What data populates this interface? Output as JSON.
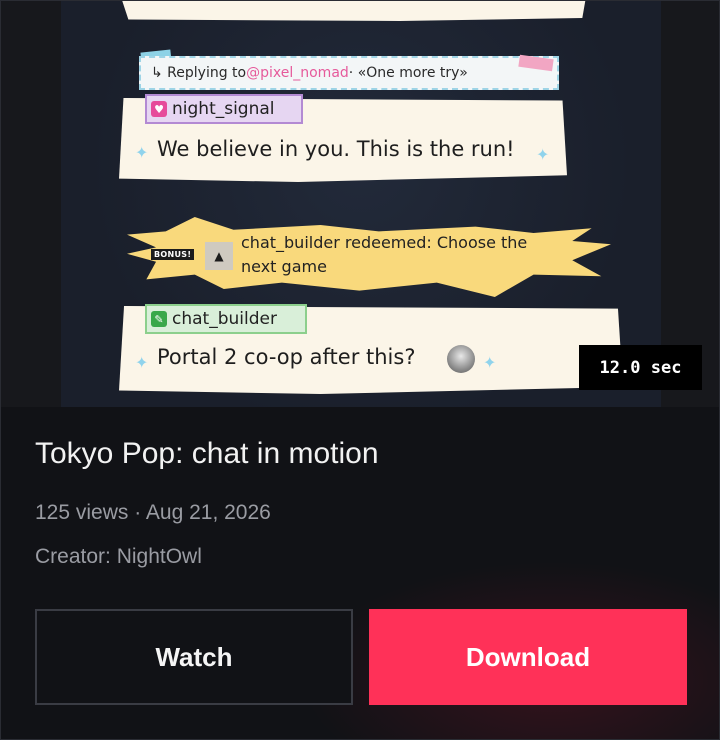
{
  "preview": {
    "reply": {
      "prefix": "↳ Replying to ",
      "mention": "@pixel_nomad",
      "suffix": " · «One more try»"
    },
    "message1": {
      "user": "night_signal",
      "text": "We believe in you. This is the run!"
    },
    "redemption": {
      "badge": "BONUS!",
      "text": "chat_builder redeemed: Choose the next game"
    },
    "message2": {
      "user": "chat_builder",
      "text": "Portal 2 co-op after this?"
    },
    "duration": "12.0 sec"
  },
  "video": {
    "title": "Tokyo Pop: chat in motion",
    "meta": "125 views · Aug 21, 2026",
    "creator": "Creator: NightOwl"
  },
  "actions": {
    "watch_label": "Watch",
    "download_label": "Download"
  },
  "colors": {
    "accent": "#ff3158",
    "background": "#111216",
    "muted_text": "#9a9ca3"
  }
}
